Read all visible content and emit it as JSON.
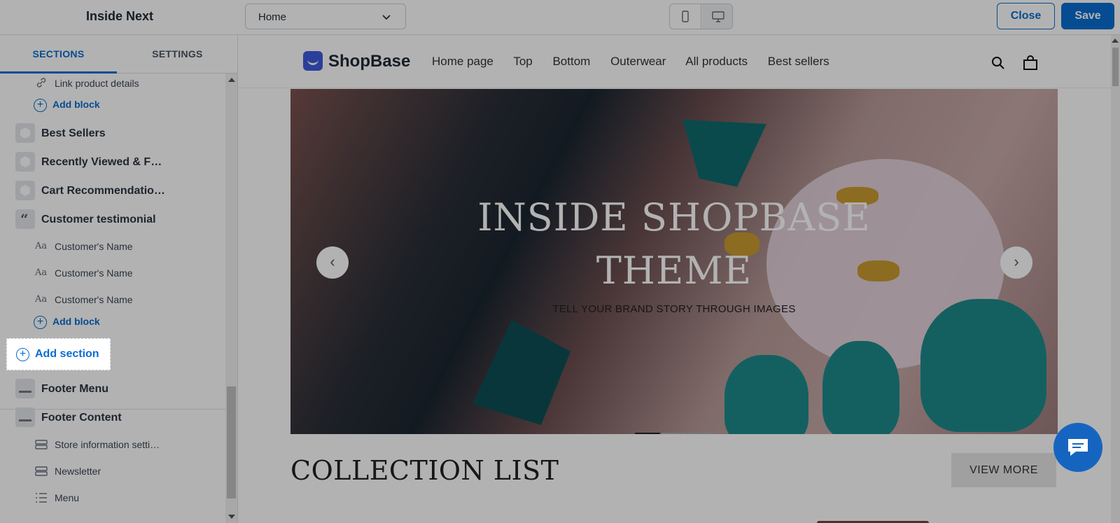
{
  "topbar": {
    "theme_title": "Inside Next",
    "page_select_value": "Home",
    "close_label": "Close",
    "save_label": "Save"
  },
  "sidebar": {
    "tabs": [
      "SECTIONS",
      "SETTINGS"
    ],
    "items": [
      {
        "kind": "block",
        "label": "Link product details",
        "icon": "link-icon"
      },
      {
        "kind": "add-block",
        "label": "Add block"
      },
      {
        "kind": "section",
        "label": "Best Sellers",
        "icon": "hexagon-icon"
      },
      {
        "kind": "section",
        "label": "Recently Viewed & F…",
        "icon": "hexagon-icon"
      },
      {
        "kind": "section",
        "label": "Cart Recommendatio…",
        "icon": "hexagon-icon"
      },
      {
        "kind": "section",
        "label": "Customer testimonial",
        "icon": "quote-icon"
      },
      {
        "kind": "block",
        "label": "Customer's Name",
        "icon": "text-icon"
      },
      {
        "kind": "block",
        "label": "Customer's Name",
        "icon": "text-icon"
      },
      {
        "kind": "block",
        "label": "Customer's Name",
        "icon": "text-icon"
      },
      {
        "kind": "add-block",
        "label": "Add block"
      }
    ],
    "add_section_label": "Add section",
    "footer_items": [
      {
        "kind": "section",
        "label": "Footer Menu",
        "icon": "footer-icon"
      },
      {
        "kind": "section",
        "label": "Footer Content",
        "icon": "footer-icon"
      },
      {
        "kind": "block",
        "label": "Store information setti…",
        "icon": "settings-block-icon"
      },
      {
        "kind": "block",
        "label": "Newsletter",
        "icon": "settings-block-icon"
      },
      {
        "kind": "block",
        "label": "Menu",
        "icon": "menu-list-icon"
      }
    ]
  },
  "preview": {
    "logo_text": "ShopBase",
    "nav": [
      "Home page",
      "Top",
      "Bottom",
      "Outerwear",
      "All products",
      "Best sellers"
    ],
    "hero_title_line1": "INSIDE SHOPBASE",
    "hero_title_line2": "THEME",
    "hero_subtitle": "TELL YOUR BRAND STORY THROUGH IMAGES",
    "collection_title": "COLLECTION LIST",
    "view_more_label": "VIEW MORE"
  },
  "colors": {
    "accent": "#0a6ed1",
    "chat_bubble": "#1565c0",
    "overlay": "rgba(0,0,0,0.3)"
  }
}
